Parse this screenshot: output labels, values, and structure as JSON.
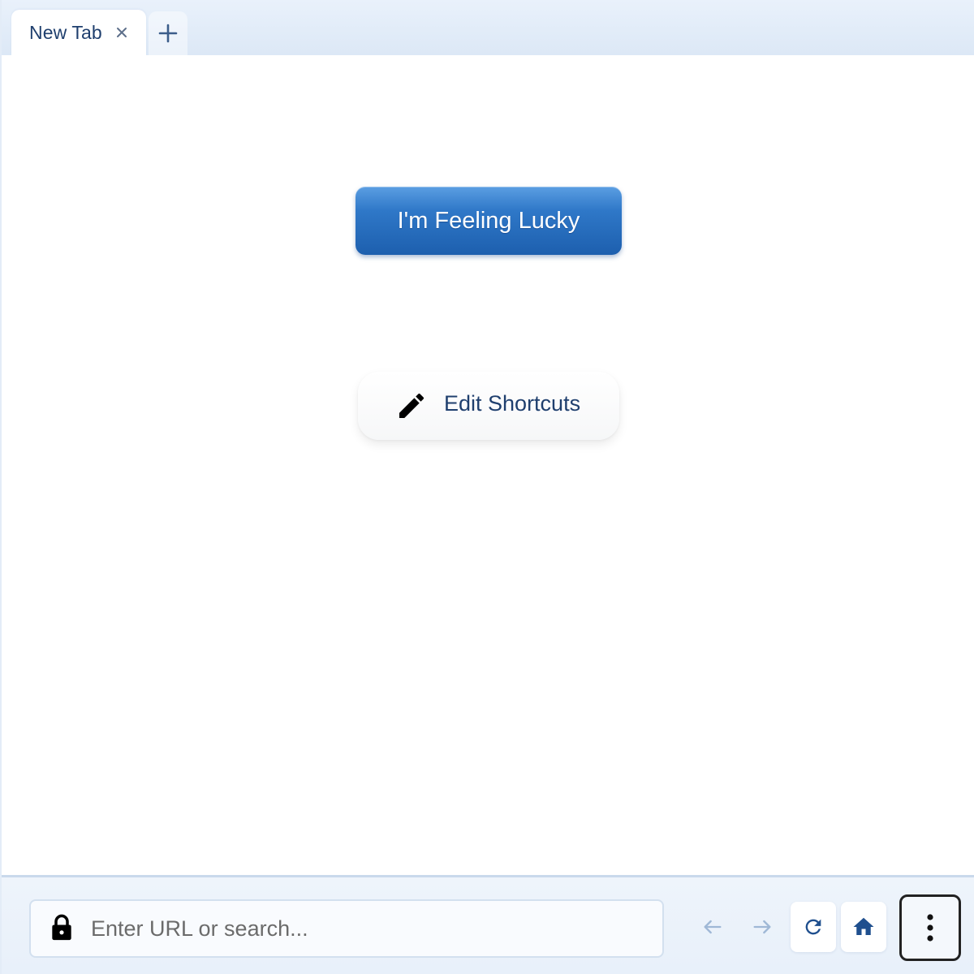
{
  "tabs": [
    {
      "title": "New Tab"
    }
  ],
  "content": {
    "lucky_button_label": "I'm Feeling Lucky",
    "edit_shortcuts_label": "Edit Shortcuts"
  },
  "toolbar": {
    "url_placeholder": "Enter URL or search...",
    "url_value": ""
  },
  "icons": {
    "tab_close": "close-icon",
    "new_tab": "plus-icon",
    "edit": "pencil-icon",
    "lock": "lock-icon",
    "back": "arrow-left-icon",
    "forward": "arrow-right-icon",
    "reload": "reload-icon",
    "home": "home-icon",
    "menu": "more-vertical-icon"
  },
  "colors": {
    "accent": "#2f78c8",
    "text_dark_blue": "#1f3f6e",
    "disabled_arrow": "#9fb8d6"
  }
}
